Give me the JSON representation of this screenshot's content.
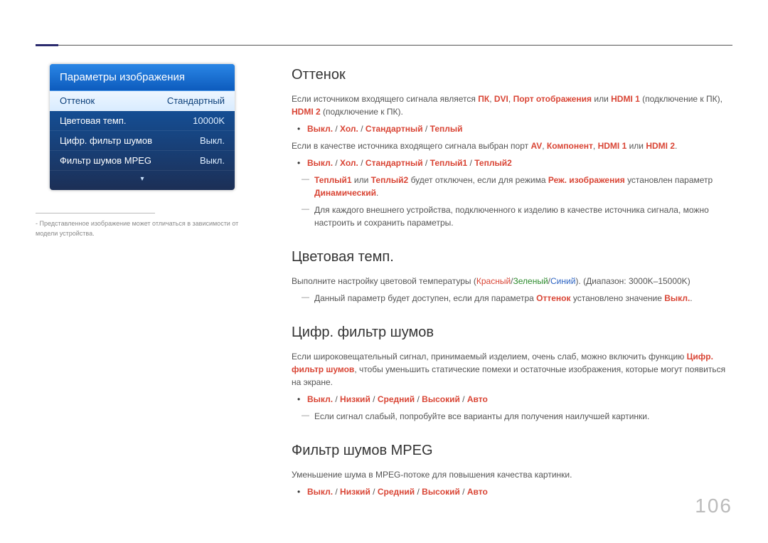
{
  "page_number": "106",
  "osd": {
    "title": "Параметры изображения",
    "rows": [
      {
        "label": "Оттенок",
        "value": "Стандартный"
      },
      {
        "label": "Цветовая темп.",
        "value": "10000K"
      },
      {
        "label": "Цифр. фильтр шумов",
        "value": "Выкл."
      },
      {
        "label": "Фильтр шумов MPEG",
        "value": "Выкл."
      }
    ],
    "more_icon": "▾"
  },
  "left_footnote": {
    "dash": "-",
    "text": "Представленное изображение может отличаться в зависимости от модели устройства."
  },
  "sections": {
    "tint": {
      "heading": "Оттенок",
      "p1a": "Если источником входящего сигнала является ",
      "p1_pk": "ПК",
      "p1_comma1": ", ",
      "p1_dvi": "DVI",
      "p1_comma2": ", ",
      "p1_port": "Порт отображения",
      "p1_or": " или ",
      "p1_h1": "HDMI 1",
      "p1_tail": " (подключение к ПК), ",
      "p1_h2": "HDMI 2",
      "p1_tail2": " (подключение к ПК).",
      "opts1": {
        "off": "Выкл.",
        "cool": "Хол.",
        "std": "Стандартный",
        "warm": "Теплый"
      },
      "p2a": "Если в качестве источника входящего сигнала выбран порт ",
      "p2_av": "AV",
      "p2_c1": ", ",
      "p2_comp": "Компонент",
      "p2_c2": ", ",
      "p2_h1": "HDMI 1",
      "p2_or": " или ",
      "p2_h2": "HDMI 2",
      "p2_dot": ".",
      "opts2": {
        "off": "Выкл.",
        "cool": "Хол.",
        "std": "Стандартный",
        "w1": "Теплый1",
        "w2": "Теплый2"
      },
      "note1a": "Теплый1",
      "note1_or": " или ",
      "note1b": "Теплый2",
      "note1_mid": " будет отключен, если для режима ",
      "note1_mode": "Реж. изображения",
      "note1_mid2": " установлен параметр ",
      "note1_dyn": "Динамический",
      "note1_dot": ".",
      "note2": "Для каждого внешнего устройства, подключенного к изделию в качестве источника сигнала, можно настроить и сохранить параметры."
    },
    "ctemp": {
      "heading": "Цветовая темп.",
      "p1a": "Выполните настройку цветовой температуры (",
      "p1_r": "Красный",
      "p1_s1": "/",
      "p1_g": "Зеленый",
      "p1_s2": "/",
      "p1_b": "Синий",
      "p1_tail": "). (Диапазон: 3000K–15000K)",
      "note_a": "Данный параметр будет доступен, если для параметра ",
      "note_t": "Оттенок",
      "note_mid": " установлено значение ",
      "note_off": "Выкл.",
      "note_dot": "."
    },
    "dnr": {
      "heading": "Цифр. фильтр шумов",
      "p1a": "Если широковещательный сигнал, принимаемый изделием, очень слаб, можно включить функцию ",
      "p1_name": "Цифр. фильтр шумов",
      "p1_tail": ", чтобы уменьшить статические помехи и остаточные изображения, которые могут появиться на экране.",
      "opts": {
        "off": "Выкл.",
        "low": "Низкий",
        "mid": "Средний",
        "high": "Высокий",
        "auto": "Авто"
      },
      "note": "Если сигнал слабый, попробуйте все варианты для получения наилучшей картинки."
    },
    "mpeg": {
      "heading": "Фильтр шумов MPEG",
      "p1": "Уменьшение шума в MPEG-потоке для повышения качества картинки.",
      "opts": {
        "off": "Выкл.",
        "low": "Низкий",
        "mid": "Средний",
        "high": "Высокий",
        "auto": "Авто"
      }
    }
  }
}
